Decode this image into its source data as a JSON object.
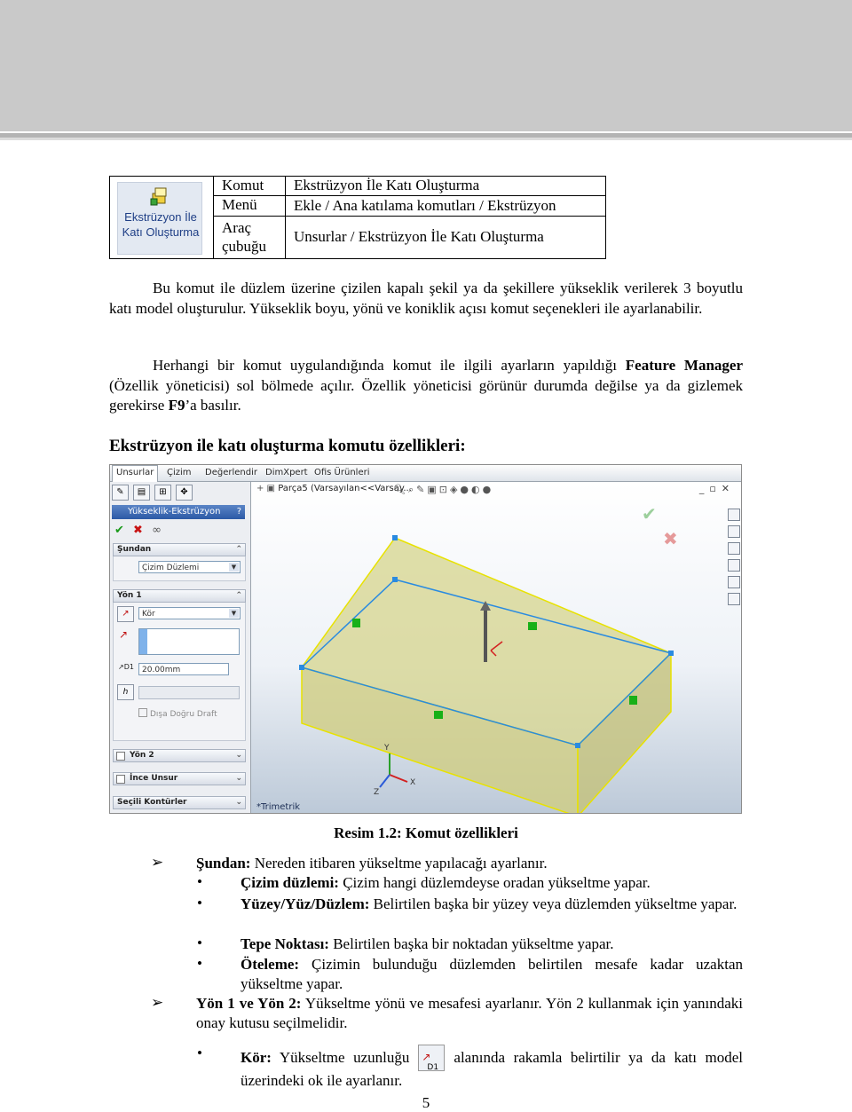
{
  "command_table": {
    "icon_label": "Ekstrüzyon İle Katı Oluşturma",
    "icon_name": "extruded-boss-icon",
    "rows": [
      {
        "label": "Komut",
        "value": "Ekstrüzyon İle Katı Oluşturma"
      },
      {
        "label": "Menü",
        "value": "Ekle / Ana katılama komutları / Ekstrüzyon"
      },
      {
        "label": "Araç çubuğu",
        "value": "Unsurlar / Ekstrüzyon İle Katı Oluşturma"
      }
    ]
  },
  "para1": "Bu komut ile düzlem üzerine çizilen kapalı şekil ya da şekillere yükseklik verilerek 3 boyutlu katı model oluşturulur. Yükseklik boyu, yönü ve koniklik açısı komut seçenekleri ile ayarlanabilir.",
  "para2": {
    "a": "Herhangi bir komut uygulandığında komut ile ilgili ayarların yapıldığı ",
    "b": "Feature Manager",
    "c": " (Özellik yöneticisi) sol bölmede açılır. Özellik yöneticisi görünür durumda değilse ya da gizlemek gerekirse ",
    "d": "F9",
    "e": "’a basılır."
  },
  "heading": "Ekstrüzyon ile katı oluşturma komutu özellikleri:",
  "screenshot": {
    "tabs": [
      "Unsurlar",
      "Çizim",
      "Değerlendir",
      "DimXpert",
      "Ofis Ürünleri"
    ],
    "breadcrumb": "Parça5 (Varsayılan<<Varsay...",
    "feature_title": "Yükseklik-Ekstrüzyon",
    "help": "?",
    "sections": {
      "from_label": "Şundan",
      "from_value": "Çizim Düzlemi",
      "dir1_label": "Yön 1",
      "dir1_type": "Kör",
      "depth": "20.00mm",
      "draft_outward": "Dışa Doğru Draft",
      "dir2_label": "Yön 2",
      "thin_label": "İnce Unsur",
      "contours_label": "Seçili Kontürler"
    },
    "view_name": "*Trimetrik",
    "axes": {
      "x": "X",
      "y": "Y",
      "z": "Z"
    },
    "colors": {
      "block_face": "#d6d48c",
      "edge": "#e8e200",
      "ribbon": "#2c5aa6",
      "background": "#eef2f7"
    }
  },
  "caption": "Resim 1.2: Komut özellikleri",
  "bullets": {
    "sundan": {
      "b": "Şundan:",
      "t": " Nereden itibaren yükseltme yapılacağı ayarlanır."
    },
    "cizim": {
      "b": "Çizim düzlemi:",
      "t": " Çizim hangi düzlemdeyse oradan yükseltme yapar."
    },
    "yuzey": {
      "b": "Yüzey/Yüz/Düzlem:",
      "t": " Belirtilen başka bir yüzey veya düzlemden yükseltme yapar."
    },
    "tepe": {
      "b": "Tepe Noktası:",
      "t": " Belirtilen başka bir noktadan yükseltme yapar."
    },
    "oteleme": {
      "b": "Öteleme:",
      "t": " Çizimin bulunduğu düzlemden belirtilen mesafe kadar uzaktan yükseltme yapar."
    },
    "yon": {
      "b": "Yön 1 ve Yön 2:",
      "t": " Yükseltme yönü ve mesafesi ayarlanır. Yön 2 kullanmak için yanındaki onay kutusu seçilmelidir."
    },
    "kor": {
      "b": "Kör:",
      "t1": " Yükseltme uzunluğu",
      "t2": "alanında rakamla belirtilir ya da katı model üzerindeki ok ile ayarlanır.",
      "icon_text": "D1"
    }
  },
  "page_number": "5"
}
